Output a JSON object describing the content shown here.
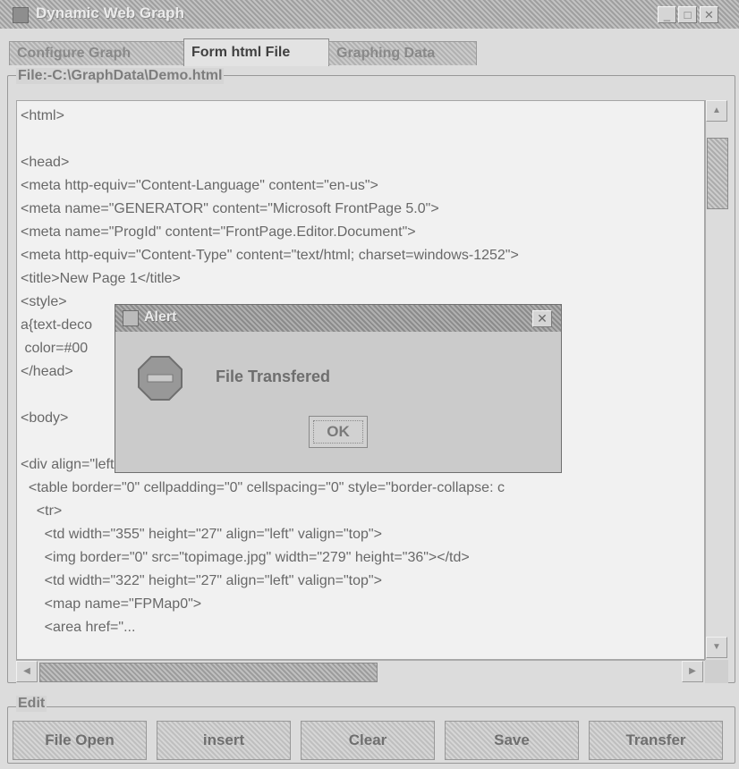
{
  "window": {
    "title": "Dynamic Web Graph",
    "controls": {
      "minimize": "_",
      "maximize": "□",
      "close": "✕"
    }
  },
  "tabs": [
    {
      "label": "Configure Graph",
      "active": false
    },
    {
      "label": "Form html File",
      "active": true
    },
    {
      "label": "Graphing Data",
      "active": false
    }
  ],
  "file_panel": {
    "legend": "File:-C:\\GraphData\\Demo.html",
    "lines": [
      "<html>",
      "",
      "<head>",
      "<meta http-equiv=\"Content-Language\" content=\"en-us\">",
      "<meta name=\"GENERATOR\" content=\"Microsoft FrontPage 5.0\">",
      "<meta name=\"ProgId\" content=\"FrontPage.Editor.Document\">",
      "<meta http-equiv=\"Content-Type\" content=\"text/html; charset=windows-1252\">",
      "<title>New Page 1</title>",
      "<style>",
      "a{text-deco",
      " color=#00",
      "</head>",
      "",
      "<body>",
      "",
      "<div align=\"left\">",
      "  <table border=\"0\" cellpadding=\"0\" cellspacing=\"0\" style=\"border-collapse: c",
      "    <tr>",
      "      <td width=\"355\" height=\"27\" align=\"left\" valign=\"top\">",
      "      <img border=\"0\" src=\"topimage.jpg\" width=\"279\" height=\"36\"></td>",
      "      <td width=\"322\" height=\"27\" align=\"left\" valign=\"top\">",
      "      <map name=\"FPMap0\">",
      "      <area href=\"..."
    ]
  },
  "edit_panel": {
    "legend": "Edit",
    "buttons": [
      "File Open",
      "insert",
      "Clear",
      "Save",
      "Transfer"
    ]
  },
  "alert": {
    "title": "Alert",
    "close": "✕",
    "message": "File Transfered",
    "ok": "OK",
    "icon": "stop-icon"
  },
  "colors": {
    "background": "#dcdcdc",
    "titlebar": "#a6a6a6",
    "editor_bg": "#fbfbfb"
  }
}
